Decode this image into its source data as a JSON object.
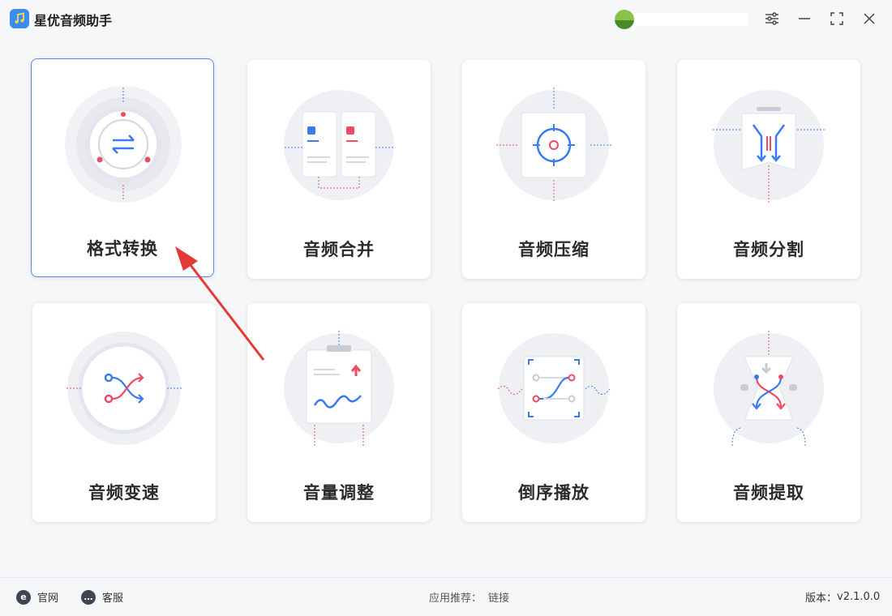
{
  "app": {
    "title": "星优音频助手",
    "logo_icon": "music-note-icon"
  },
  "window_controls": {
    "settings_icon": "sliders-icon",
    "minimize_icon": "minimize-icon",
    "maximize_icon": "fullscreen-icon",
    "close_icon": "close-icon"
  },
  "features": [
    {
      "label": "格式转换",
      "icon": "format-convert-icon",
      "active": true
    },
    {
      "label": "音频合并",
      "icon": "audio-merge-icon"
    },
    {
      "label": "音频压缩",
      "icon": "audio-compress-icon"
    },
    {
      "label": "音频分割",
      "icon": "audio-split-icon"
    },
    {
      "label": "音频变速",
      "icon": "audio-speed-icon"
    },
    {
      "label": "音量调整",
      "icon": "volume-adjust-icon"
    },
    {
      "label": "倒序播放",
      "icon": "reverse-play-icon"
    },
    {
      "label": "音频提取",
      "icon": "audio-extract-icon"
    }
  ],
  "footer": {
    "website_label": "官网",
    "support_label": "客服",
    "recommend_label": "应用推荐：",
    "recommend_link": "链接",
    "version_label": "版本：",
    "version_value": "v2.1.0.0"
  },
  "colors": {
    "accent": "#3a7bf0",
    "red": "#f04a64",
    "card_border_active": "#4b8ef0"
  }
}
